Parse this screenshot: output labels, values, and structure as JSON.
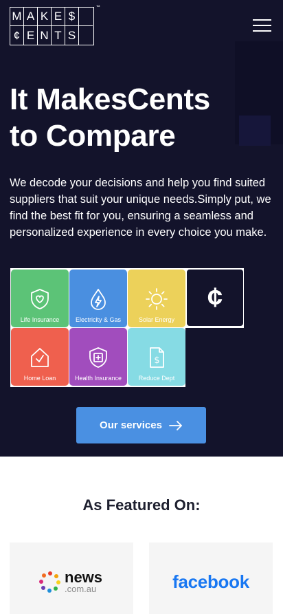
{
  "brand": {
    "logo_row1": [
      "M",
      "A",
      "K",
      "E",
      "$",
      ""
    ],
    "logo_row2": [
      "¢",
      "E",
      "N",
      "T",
      "S",
      ""
    ],
    "trademark": "™"
  },
  "header": {
    "menu_icon": "hamburger-menu-icon"
  },
  "hero": {
    "title_line1": "It MakesCents",
    "title_line2": "to Compare",
    "description": "We decode your decisions and help you find suited suppliers that suit your unique needs.Simply put, we find the best fit for you, ensuring a seamless and personalized experience in every choice you make.",
    "background_color": "#13132b"
  },
  "services": [
    {
      "label": "Life Insurance",
      "icon": "shield-heart-icon",
      "color": "#5cc377"
    },
    {
      "label": "Electricity & Gas",
      "icon": "energy-drop-icon",
      "color": "#4a8fe0"
    },
    {
      "label": "Solar Energy",
      "icon": "sun-icon",
      "color": "#ecd15a"
    },
    {
      "label": "Home Loan",
      "icon": "home-check-icon",
      "color": "#ef604e"
    },
    {
      "label": "Health Insurance",
      "icon": "shield-plus-icon",
      "color": "#a14dbd"
    },
    {
      "label": "Reduce Dept",
      "icon": "dollar-document-icon",
      "color": "#86dbe4"
    }
  ],
  "cent_tile": {
    "glyph": "¢"
  },
  "cta": {
    "label": "Our services",
    "icon": "arrow-right-icon",
    "color": "#4a90e2"
  },
  "featured": {
    "heading": "As Featured On:",
    "items": [
      {
        "name": "news",
        "sub": ".com.au",
        "icon": "news-dots-icon"
      },
      {
        "name": "facebook",
        "color": "#1877f2"
      }
    ]
  }
}
